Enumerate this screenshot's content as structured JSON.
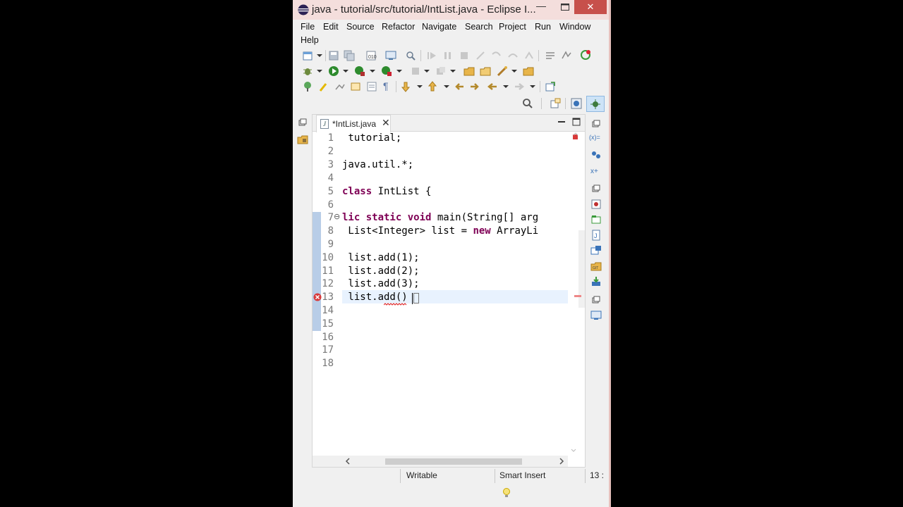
{
  "window": {
    "title": "java - tutorial/src/tutorial/IntList.java - Eclipse I...",
    "minimize": "—",
    "close": "✕"
  },
  "menu": [
    "File",
    "Edit",
    "Source",
    "Refactor",
    "Navigate",
    "Search",
    "Project",
    "Run",
    "Window",
    "Help"
  ],
  "editor": {
    "tab_label": "*IntList.java",
    "tab_close": "✕",
    "line_numbers": [
      "1",
      "2",
      "3",
      "4",
      "5",
      "6",
      "7",
      "8",
      "9",
      "10",
      "11",
      "12",
      "13",
      "14",
      "15",
      "16",
      "17",
      "18"
    ],
    "fold_marker": "⊖"
  },
  "code": {
    "l1": " tutorial;",
    "l3": "java.util.*;",
    "l5_kw": "class",
    "l5_rest": " IntList {",
    "l7_kw": "lic static void",
    "l7_rest": " main(String[] arg",
    "l8_a": " List<Integer> list = ",
    "l8_kw": "new",
    "l8_b": " ArrayLi",
    "l10": " list.add(1);",
    "l11": " list.add(2);",
    "l12": " list.add(3);",
    "l13": " list.add()"
  },
  "status": {
    "writable": "Writable",
    "insert_mode": "Smart Insert",
    "position": "13 :"
  },
  "colors": {
    "keyword": "#7f0055",
    "titlebar": "#f4dedc",
    "close_button": "#c7504b",
    "line_highlight": "#e8f2fe",
    "change_ruler": "#b8cde7"
  }
}
